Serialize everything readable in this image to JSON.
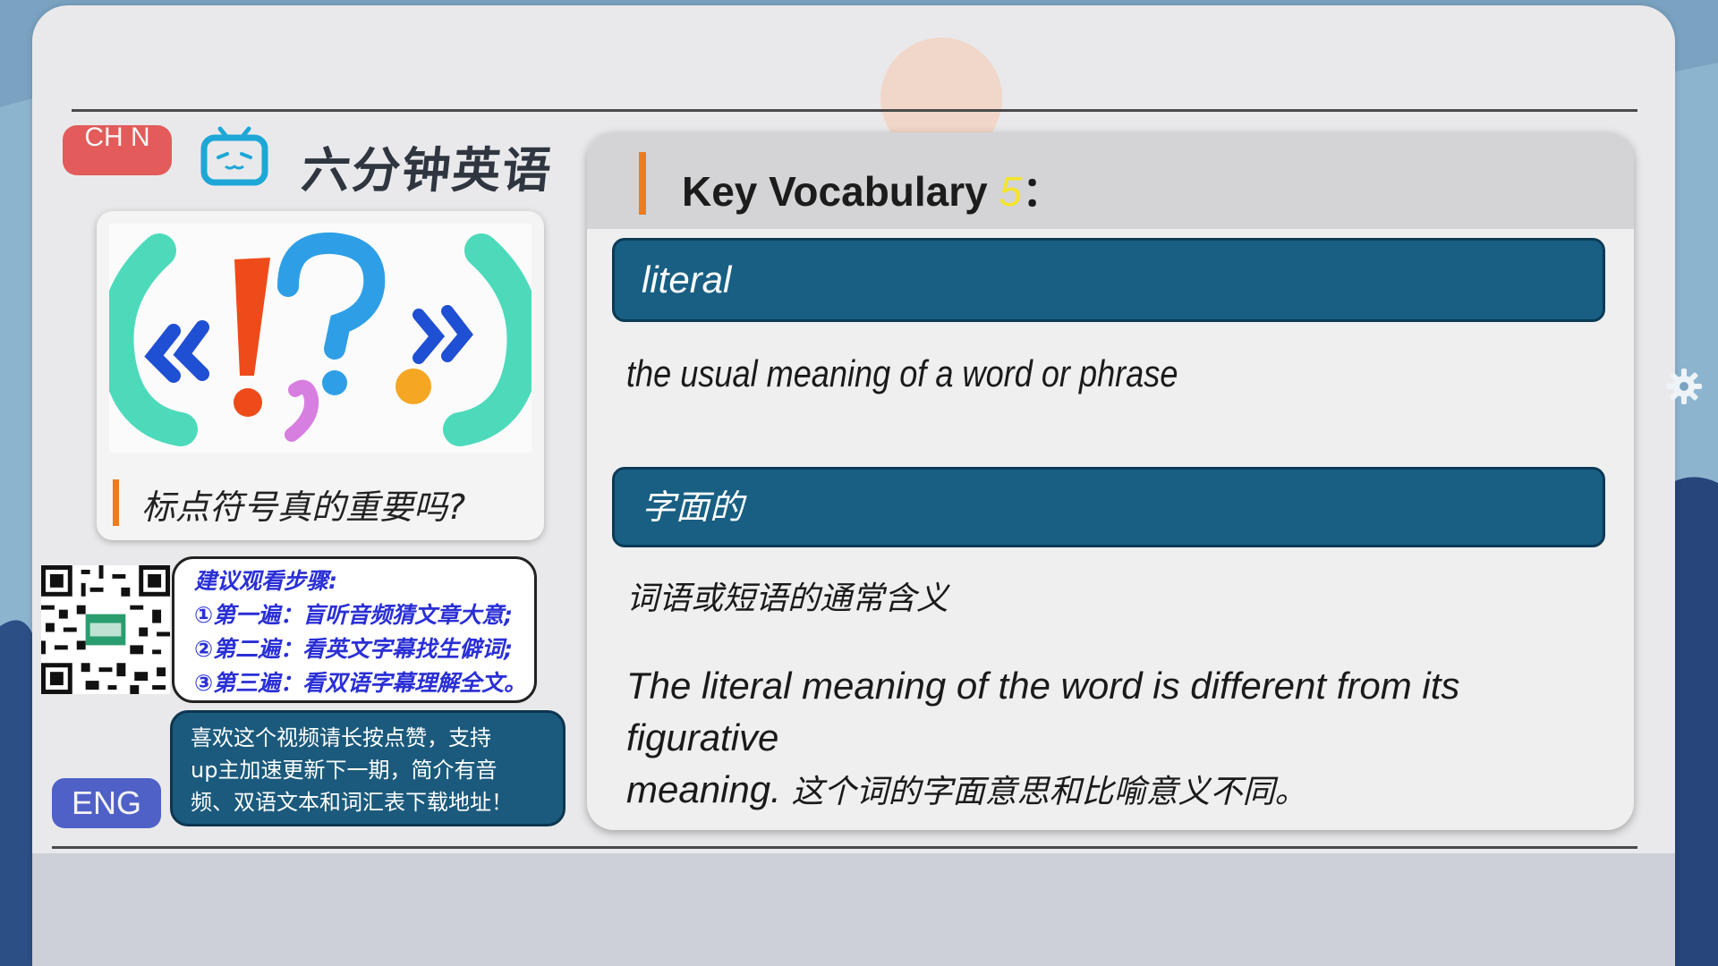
{
  "lang_buttons": {
    "chn": "CH N",
    "eng": "ENG"
  },
  "brand": {
    "name": "六分钟英语"
  },
  "thumbnail": {
    "title": "标点符号真的重要吗?"
  },
  "steps": {
    "heading": "建议观看步骤:",
    "items": [
      "①第一遍：盲听音频猜文章大意;",
      "②第二遍：看英文字幕找生僻词;",
      "③第三遍：看双语字幕理解全文。"
    ]
  },
  "support": {
    "lines": [
      "喜欢这个视频请长按点赞，支持",
      "up主加速更新下一期，简介有音",
      "频、双语文本和词汇表下载地址！"
    ]
  },
  "vocab": {
    "title": "Key Vocabulary",
    "number": "5",
    "colon": "：",
    "word_en": "literal",
    "definition_en": "the usual meaning of a word or phrase",
    "word_zh": "字面的",
    "definition_zh": "词语或短语的通常含义",
    "example_en_1": "The literal meaning of the word is different from its figurative",
    "example_en_2": "meaning.",
    "example_zh": "这个词的字面意思和比喻意义不同。"
  },
  "colors": {
    "accent_orange": "#f07b1d",
    "word_bar": "#185f83",
    "chn_button": "#e35b5b",
    "eng_button": "#4f61c7",
    "steps_text": "#2a2fd6"
  },
  "icons": [
    "tv-logo-icon",
    "gear-icon",
    "qr-code"
  ]
}
